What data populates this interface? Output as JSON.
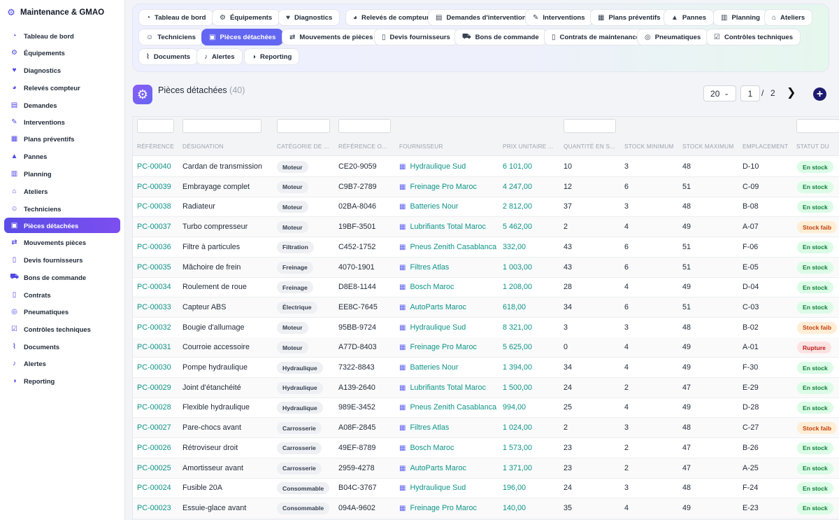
{
  "app": {
    "title": "Maintenance & GMAO"
  },
  "sidebar": {
    "items": [
      {
        "label": "Tableau de bord",
        "icon": "dashboard-gauge-icon",
        "glyph": "◔",
        "active": false
      },
      {
        "label": "Équipements",
        "icon": "gears-icon",
        "glyph": "⚙",
        "active": false
      },
      {
        "label": "Diagnostics",
        "icon": "heart-pulse-icon",
        "glyph": "♥",
        "active": false
      },
      {
        "label": "Relevés compteur",
        "icon": "gauge-icon",
        "glyph": "◕",
        "active": false
      },
      {
        "label": "Demandes",
        "icon": "clipboard-icon",
        "glyph": "▤",
        "active": false
      },
      {
        "label": "Interventions",
        "icon": "wrench-icon",
        "glyph": "✎",
        "active": false
      },
      {
        "label": "Plans préventifs",
        "icon": "calendar-check-icon",
        "glyph": "▦",
        "active": false
      },
      {
        "label": "Pannes",
        "icon": "warning-triangle-icon",
        "glyph": "▲",
        "active": false
      },
      {
        "label": "Planning",
        "icon": "calendar-icon",
        "glyph": "▥",
        "active": false
      },
      {
        "label": "Ateliers",
        "icon": "warehouse-icon",
        "glyph": "⌂",
        "active": false
      },
      {
        "label": "Techniciens",
        "icon": "users-gear-icon",
        "glyph": "☺",
        "active": false
      },
      {
        "label": "Pièces détachées",
        "icon": "boxes-icon",
        "glyph": "▣",
        "active": true
      },
      {
        "label": "Mouvements pièces",
        "icon": "dolly-icon",
        "glyph": "⇄",
        "active": false
      },
      {
        "label": "Devis fournisseurs",
        "icon": "file-invoice-icon",
        "glyph": "▯",
        "active": false
      },
      {
        "label": "Bons de commande",
        "icon": "cart-icon",
        "glyph": "⛟",
        "active": false
      },
      {
        "label": "Contrats",
        "icon": "file-contract-icon",
        "glyph": "▯",
        "active": false
      },
      {
        "label": "Pneumatiques",
        "icon": "tire-icon",
        "glyph": "◎",
        "active": false
      },
      {
        "label": "Contrôles techniques",
        "icon": "clipboard-check-icon",
        "glyph": "☑",
        "active": false
      },
      {
        "label": "Documents",
        "icon": "paperclip-icon",
        "glyph": "⌇",
        "active": false
      },
      {
        "label": "Alertes",
        "icon": "bell-icon",
        "glyph": "♪",
        "active": false
      },
      {
        "label": "Reporting",
        "icon": "chart-pie-icon",
        "glyph": "◑",
        "active": false
      }
    ]
  },
  "topnav": {
    "tabs": [
      {
        "label": "Tableau de bord",
        "icon": "dashboard-gauge-icon",
        "glyph": "◔",
        "active": false
      },
      {
        "label": "Équipements",
        "icon": "gears-icon",
        "glyph": "⚙",
        "active": false
      },
      {
        "label": "Diagnostics",
        "icon": "heart-pulse-icon",
        "glyph": "♥",
        "active": false
      },
      {
        "label": "Relevés de compteur",
        "icon": "gauge-icon",
        "glyph": "◕",
        "active": false
      },
      {
        "label": "Demandes d'intervention",
        "icon": "clipboard-icon",
        "glyph": "▤",
        "active": false
      },
      {
        "label": "Interventions",
        "icon": "wrench-icon",
        "glyph": "✎",
        "active": false
      },
      {
        "label": "Plans préventifs",
        "icon": "calendar-check-icon",
        "glyph": "▦",
        "active": false
      },
      {
        "label": "Pannes",
        "icon": "warning-triangle-icon",
        "glyph": "▲",
        "active": false
      },
      {
        "label": "Planning",
        "icon": "calendar-icon",
        "glyph": "▥",
        "active": false
      },
      {
        "label": "Ateliers",
        "icon": "warehouse-icon",
        "glyph": "⌂",
        "active": false
      },
      {
        "label": "Techniciens",
        "icon": "users-gear-icon",
        "glyph": "☺",
        "active": false
      },
      {
        "label": "Pièces détachées",
        "icon": "boxes-icon",
        "glyph": "▣",
        "active": true
      },
      {
        "label": "Mouvements de pièces",
        "icon": "dolly-icon",
        "glyph": "⇄",
        "active": false
      },
      {
        "label": "Devis fournisseurs",
        "icon": "file-invoice-icon",
        "glyph": "▯",
        "active": false
      },
      {
        "label": "Bons de commande",
        "icon": "cart-icon",
        "glyph": "⛟",
        "active": false
      },
      {
        "label": "Contrats de maintenance",
        "icon": "file-contract-icon",
        "glyph": "▯",
        "active": false
      },
      {
        "label": "Pneumatiques",
        "icon": "tire-icon",
        "glyph": "◎",
        "active": false
      },
      {
        "label": "Contrôles techniques",
        "icon": "clipboard-check-icon",
        "glyph": "☑",
        "active": false
      },
      {
        "label": "Documents",
        "icon": "paperclip-icon",
        "glyph": "⌇",
        "active": false
      },
      {
        "label": "Alertes",
        "icon": "bell-icon",
        "glyph": "♪",
        "active": false
      },
      {
        "label": "Reporting",
        "icon": "chart-pie-icon",
        "glyph": "◑",
        "active": false
      }
    ]
  },
  "header": {
    "title": "Pièces détachées",
    "count": "(40)",
    "page_size": "20",
    "current_page": "1",
    "separator": "/",
    "total_pages": "2",
    "next_glyph": "❯",
    "add_glyph": "+"
  },
  "table": {
    "columns": [
      {
        "label": "RÉFÉRENCE"
      },
      {
        "label": "DÉSIGNATION"
      },
      {
        "label": "CATÉGORIE DE ..."
      },
      {
        "label": "RÉFÉRENCE O..."
      },
      {
        "label": "FOURNISSEUR"
      },
      {
        "label": "PRIX UNITAIRE ..."
      },
      {
        "label": "QUANTITÉ EN S..."
      },
      {
        "label": "STOCK MINIMUM"
      },
      {
        "label": "STOCK MAXIMUM"
      },
      {
        "label": "EMPLACEMENT"
      },
      {
        "label": "STATUT DU"
      }
    ],
    "rows": [
      {
        "ref": "PC-00040",
        "designation": "Cardan de transmission",
        "category": "Moteur",
        "oem": "CE20-9059",
        "supplier": "Hydraulique Sud",
        "price": "6 101,00",
        "qty": "10",
        "min": "3",
        "max": "48",
        "location": "D-10",
        "status": "En stock",
        "status_kind": "ok"
      },
      {
        "ref": "PC-00039",
        "designation": "Embrayage complet",
        "category": "Moteur",
        "oem": "C9B7-2789",
        "supplier": "Freinage Pro Maroc",
        "price": "4 247,00",
        "qty": "12",
        "min": "6",
        "max": "51",
        "location": "C-09",
        "status": "En stock",
        "status_kind": "ok"
      },
      {
        "ref": "PC-00038",
        "designation": "Radiateur",
        "category": "Moteur",
        "oem": "02BA-8046",
        "supplier": "Batteries Nour",
        "price": "2 812,00",
        "qty": "37",
        "min": "3",
        "max": "48",
        "location": "B-08",
        "status": "En stock",
        "status_kind": "ok"
      },
      {
        "ref": "PC-00037",
        "designation": "Turbo compresseur",
        "category": "Moteur",
        "oem": "19BF-3501",
        "supplier": "Lubrifiants Total Maroc",
        "price": "5 462,00",
        "qty": "2",
        "min": "4",
        "max": "49",
        "location": "A-07",
        "status": "Stock faib",
        "status_kind": "low"
      },
      {
        "ref": "PC-00036",
        "designation": "Filtre à particules",
        "category": "Filtration",
        "oem": "C452-1752",
        "supplier": "Pneus Zenith Casablanca",
        "price": "332,00",
        "qty": "43",
        "min": "6",
        "max": "51",
        "location": "F-06",
        "status": "En stock",
        "status_kind": "ok"
      },
      {
        "ref": "PC-00035",
        "designation": "Mâchoire de frein",
        "category": "Freinage",
        "oem": "4070-1901",
        "supplier": "Filtres Atlas",
        "price": "1 003,00",
        "qty": "43",
        "min": "6",
        "max": "51",
        "location": "E-05",
        "status": "En stock",
        "status_kind": "ok"
      },
      {
        "ref": "PC-00034",
        "designation": "Roulement de roue",
        "category": "Freinage",
        "oem": "D8E8-1144",
        "supplier": "Bosch Maroc",
        "price": "1 208,00",
        "qty": "28",
        "min": "4",
        "max": "49",
        "location": "D-04",
        "status": "En stock",
        "status_kind": "ok"
      },
      {
        "ref": "PC-00033",
        "designation": "Capteur ABS",
        "category": "Électrique",
        "oem": "EE8C-7645",
        "supplier": "AutoParts Maroc",
        "price": "618,00",
        "qty": "34",
        "min": "6",
        "max": "51",
        "location": "C-03",
        "status": "En stock",
        "status_kind": "ok"
      },
      {
        "ref": "PC-00032",
        "designation": "Bougie d'allumage",
        "category": "Moteur",
        "oem": "95BB-9724",
        "supplier": "Hydraulique Sud",
        "price": "8 321,00",
        "qty": "3",
        "min": "3",
        "max": "48",
        "location": "B-02",
        "status": "Stock faib",
        "status_kind": "low"
      },
      {
        "ref": "PC-00031",
        "designation": "Courroie accessoire",
        "category": "Moteur",
        "oem": "A77D-8403",
        "supplier": "Freinage Pro Maroc",
        "price": "5 625,00",
        "qty": "0",
        "min": "4",
        "max": "49",
        "location": "A-01",
        "status": "Rupture",
        "status_kind": "out"
      },
      {
        "ref": "PC-00030",
        "designation": "Pompe hydraulique",
        "category": "Hydraulique",
        "oem": "7322-8843",
        "supplier": "Batteries Nour",
        "price": "1 394,00",
        "qty": "34",
        "min": "4",
        "max": "49",
        "location": "F-30",
        "status": "En stock",
        "status_kind": "ok"
      },
      {
        "ref": "PC-00029",
        "designation": "Joint d'étanchéité",
        "category": "Hydraulique",
        "oem": "A139-2640",
        "supplier": "Lubrifiants Total Maroc",
        "price": "1 500,00",
        "qty": "24",
        "min": "2",
        "max": "47",
        "location": "E-29",
        "status": "En stock",
        "status_kind": "ok"
      },
      {
        "ref": "PC-00028",
        "designation": "Flexible hydraulique",
        "category": "Hydraulique",
        "oem": "989E-3452",
        "supplier": "Pneus Zenith Casablanca",
        "price": "994,00",
        "qty": "25",
        "min": "4",
        "max": "49",
        "location": "D-28",
        "status": "En stock",
        "status_kind": "ok"
      },
      {
        "ref": "PC-00027",
        "designation": "Pare-chocs avant",
        "category": "Carrosserie",
        "oem": "A08F-2845",
        "supplier": "Filtres Atlas",
        "price": "1 024,00",
        "qty": "2",
        "min": "3",
        "max": "48",
        "location": "C-27",
        "status": "Stock faib",
        "status_kind": "low"
      },
      {
        "ref": "PC-00026",
        "designation": "Rétroviseur droit",
        "category": "Carrosserie",
        "oem": "49EF-8789",
        "supplier": "Bosch Maroc",
        "price": "1 573,00",
        "qty": "23",
        "min": "2",
        "max": "47",
        "location": "B-26",
        "status": "En stock",
        "status_kind": "ok"
      },
      {
        "ref": "PC-00025",
        "designation": "Amortisseur avant",
        "category": "Carrosserie",
        "oem": "2959-4278",
        "supplier": "AutoParts Maroc",
        "price": "1 371,00",
        "qty": "23",
        "min": "2",
        "max": "47",
        "location": "A-25",
        "status": "En stock",
        "status_kind": "ok"
      },
      {
        "ref": "PC-00024",
        "designation": "Fusible 20A",
        "category": "Consommable",
        "oem": "B04C-3767",
        "supplier": "Hydraulique Sud",
        "price": "196,00",
        "qty": "24",
        "min": "3",
        "max": "48",
        "location": "F-24",
        "status": "En stock",
        "status_kind": "ok"
      },
      {
        "ref": "PC-00023",
        "designation": "Essuie-glace avant",
        "category": "Consommable",
        "oem": "094A-9602",
        "supplier": "Freinage Pro Maroc",
        "price": "140,00",
        "qty": "35",
        "min": "4",
        "max": "49",
        "location": "E-23",
        "status": "En stock",
        "status_kind": "ok"
      }
    ]
  },
  "colors": {
    "accent": "#6366f1",
    "link": "#0d9488",
    "ok": "#15803d",
    "low": "#c2410c",
    "out": "#b91c1c"
  }
}
